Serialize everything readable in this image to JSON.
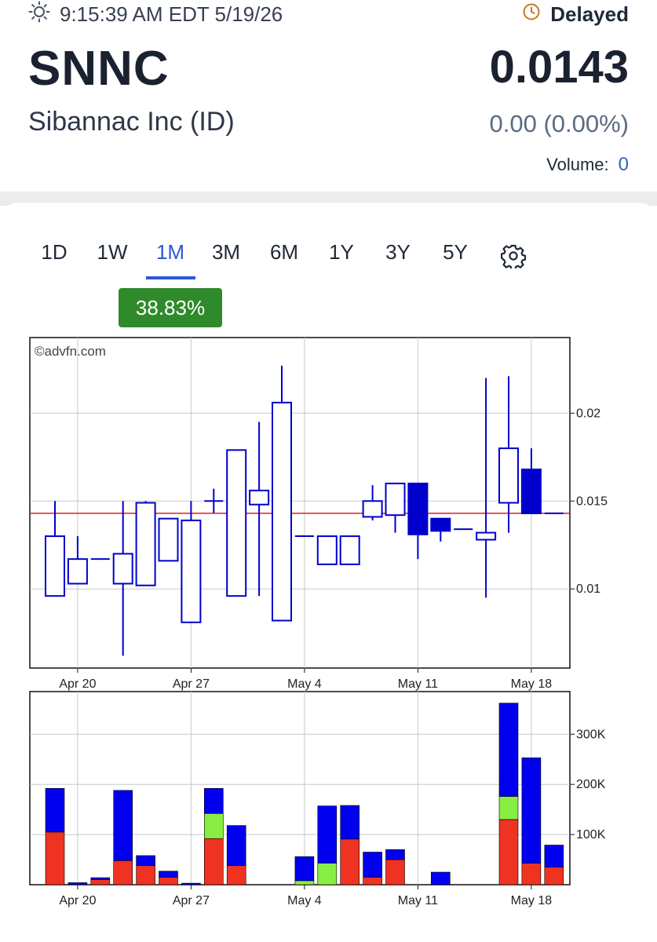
{
  "status": {
    "time": "9:15:39 AM EDT 5/19/26",
    "delayed": "Delayed"
  },
  "quote": {
    "symbol": "SNNC",
    "company": "Sibannac Inc (ID)",
    "price": "0.0143",
    "change": "0.00 (0.00%)",
    "volume_label": "Volume:",
    "volume_value": "0"
  },
  "tabs": [
    "1D",
    "1W",
    "1M",
    "3M",
    "6M",
    "1Y",
    "3Y",
    "5Y"
  ],
  "active_tab": "1M",
  "icons": {
    "sun": "sun-icon",
    "clock": "clock-icon",
    "settings": "gear-icon"
  },
  "colors": {
    "accent": "#2b58d8",
    "positive": "#2f8a2c",
    "candle": "#0000cc",
    "ref_line": "#e02020",
    "vol_up": "#88ee44",
    "vol_down": "#ee3322",
    "vol_neutral": "#0000ee"
  },
  "performance": "38.83%",
  "chart_data": [
    {
      "type": "candlestick",
      "watermark": "©advfn.com",
      "x_tick_labels": [
        "Apr 20",
        "Apr 27",
        "May 4",
        "May 11",
        "May 18"
      ],
      "y_tick_labels": [
        "0.01",
        "0.015",
        "0.02"
      ],
      "ylim": [
        0.0055,
        0.0243
      ],
      "reference_line": 0.0143,
      "candles": [
        {
          "o": 0.0096,
          "h": 0.015,
          "l": 0.0096,
          "c": 0.013
        },
        {
          "o": 0.0103,
          "h": 0.013,
          "l": 0.0103,
          "c": 0.0117
        },
        {
          "o": 0.0117,
          "h": 0.0117,
          "l": 0.0117,
          "c": 0.0117
        },
        {
          "o": 0.0103,
          "h": 0.015,
          "l": 0.0062,
          "c": 0.012
        },
        {
          "o": 0.0102,
          "h": 0.015,
          "l": 0.0102,
          "c": 0.0149
        },
        {
          "o": 0.0116,
          "h": 0.014,
          "l": 0.0116,
          "c": 0.014
        },
        {
          "o": 0.0081,
          "h": 0.015,
          "l": 0.0081,
          "c": 0.0139
        },
        {
          "o": 0.015,
          "h": 0.0157,
          "l": 0.0143,
          "c": 0.015
        },
        {
          "o": 0.0096,
          "h": 0.015,
          "l": 0.0096,
          "c": 0.0179
        },
        {
          "o": 0.0148,
          "h": 0.0195,
          "l": 0.0096,
          "c": 0.0156
        },
        {
          "o": 0.0082,
          "h": 0.0227,
          "l": 0.0082,
          "c": 0.0206
        },
        {
          "o": 0.013,
          "h": 0.013,
          "l": 0.013,
          "c": 0.013
        },
        {
          "o": 0.0114,
          "h": 0.013,
          "l": 0.0114,
          "c": 0.013
        },
        {
          "o": 0.0114,
          "h": 0.013,
          "l": 0.0114,
          "c": 0.013
        },
        {
          "o": 0.0141,
          "h": 0.0159,
          "l": 0.0139,
          "c": 0.015
        },
        {
          "o": 0.0142,
          "h": 0.016,
          "l": 0.0132,
          "c": 0.016
        },
        {
          "o": 0.016,
          "h": 0.016,
          "l": 0.0117,
          "c": 0.0131
        },
        {
          "o": 0.014,
          "h": 0.014,
          "l": 0.0127,
          "c": 0.0133
        },
        {
          "o": 0.0134,
          "h": 0.0134,
          "l": 0.0134,
          "c": 0.0134
        },
        {
          "o": 0.0128,
          "h": 0.022,
          "l": 0.0095,
          "c": 0.0132
        },
        {
          "o": 0.0149,
          "h": 0.0221,
          "l": 0.0132,
          "c": 0.018
        },
        {
          "o": 0.0168,
          "h": 0.018,
          "l": 0.0143,
          "c": 0.0143
        },
        {
          "o": 0.0143,
          "h": 0.0143,
          "l": 0.0143,
          "c": 0.0143
        }
      ]
    },
    {
      "type": "bar",
      "stacked": true,
      "x_tick_labels": [
        "Apr 20",
        "Apr 27",
        "May 4",
        "May 11",
        "May 18"
      ],
      "y_tick_labels": [
        "100K",
        "200K",
        "300K"
      ],
      "ylim": [
        0,
        385000
      ],
      "series_order": [
        "down",
        "up",
        "neutral"
      ],
      "volume": [
        {
          "down": 105000,
          "up": 0,
          "neutral": 87000
        },
        {
          "down": 0,
          "up": 0,
          "neutral": 4000
        },
        {
          "down": 10000,
          "up": 0,
          "neutral": 4000
        },
        {
          "down": 48000,
          "up": 0,
          "neutral": 140000
        },
        {
          "down": 38000,
          "up": 0,
          "neutral": 20000
        },
        {
          "down": 15000,
          "up": 0,
          "neutral": 12000
        },
        {
          "down": 0,
          "up": 0,
          "neutral": 3000
        },
        {
          "down": 92000,
          "up": 50000,
          "neutral": 50000
        },
        {
          "down": 38000,
          "up": 0,
          "neutral": 80000
        },
        {
          "down": 0,
          "up": 0,
          "neutral": 0
        },
        {
          "down": 0,
          "up": 8000,
          "neutral": 48000
        },
        {
          "down": 0,
          "up": 43000,
          "neutral": 114000
        },
        {
          "down": 91000,
          "up": 0,
          "neutral": 67000
        },
        {
          "down": 15000,
          "up": 0,
          "neutral": 50000
        },
        {
          "down": 50000,
          "up": 0,
          "neutral": 20000
        },
        {
          "down": 0,
          "up": 0,
          "neutral": 25000
        },
        {
          "down": 0,
          "up": 0,
          "neutral": 0
        },
        {
          "down": 130000,
          "up": 46000,
          "neutral": 186000
        },
        {
          "down": 43000,
          "up": 0,
          "neutral": 210000
        },
        {
          "down": 35000,
          "up": 0,
          "neutral": 44000
        }
      ]
    }
  ]
}
